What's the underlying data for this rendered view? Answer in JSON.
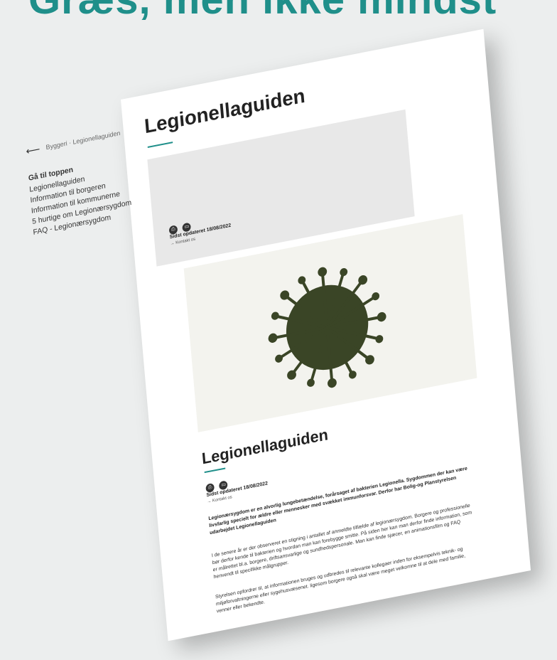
{
  "banner": {
    "text": "Græs, men ikke mindst"
  },
  "breadcrumb": {
    "arrow": "⟵",
    "text": "Byggeri · Legionellaguiden"
  },
  "nav": {
    "heading": "Gå til toppen",
    "items": [
      "Legionellaguiden",
      "Information til borgeren",
      "Information til kommunerne",
      "5 hurtige om Legionærsygdom",
      "FAQ - Legionærsygdom"
    ]
  },
  "page": {
    "title": "Legionellaguiden",
    "infobox": {
      "updated": "Sidst opdateret 18/08/2022",
      "contact": "→ Kontakt os"
    },
    "section": {
      "title": "Legionellaguiden",
      "updated": "Sidst opdateret 18/08/2022",
      "contact": "→ Kontakt os",
      "intro": "Legionærsygdom er en alvorlig lungebetændelse, forårsaget af bakterien Legionella. Sygdommen der kan være livsfarlig specielt for ældre eller mennesker med svækket immunforsvar. Derfor har Bolig-og Planstyrelsen udarbejdet Legionellaguiden",
      "paragraph1": "I de senere år er der observeret en stigning i antallet af anmeldte tilfælde af legionærsygdom. Borgere og professionelle bør derfor kende til bakterien og hvordan man kan forebygge smitte. På siden her kan man derfor finde information, som er målrettet bl.a. borgere, driftsansvarlige og sundhedspersonale. Man kan finde sjæcer, en animationsfilm og FAQ henvendt til specifikke målgrupper.",
      "paragraph2": "Styrelsen opfordrer til, at informationen bruges og udbredes til relevante kollegaer inden for eksempelvis teknik- og miljøforvaltningerne eller sygehusvæsenet. ligesom borgere også skal være meget velkomne til at dele med familie, venner eller bekendte."
    }
  },
  "icons": [
    "print-icon",
    "download-icon"
  ],
  "colors": {
    "accent": "#1f8f8a",
    "virus": "#3a4526",
    "banner": "#1f8f8a"
  }
}
